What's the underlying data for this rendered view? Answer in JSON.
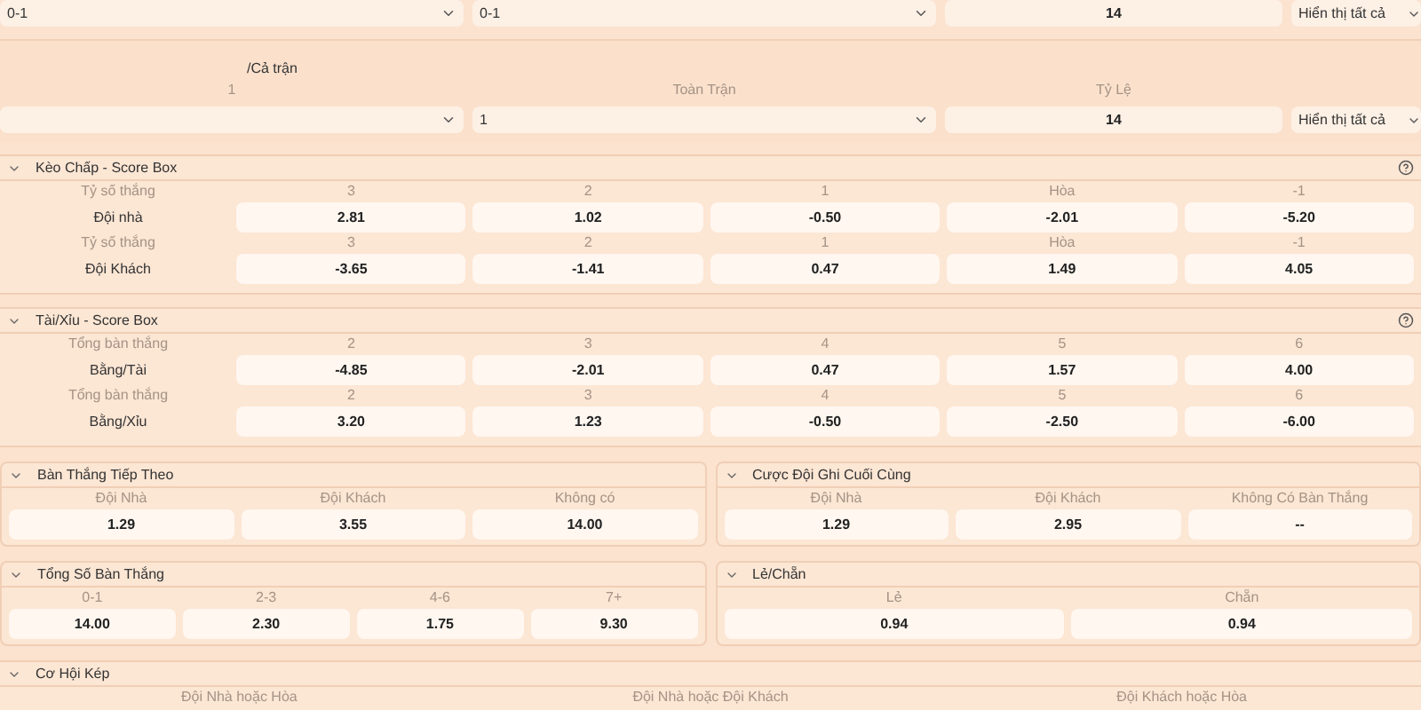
{
  "top_row": {
    "fields": [
      {
        "kind": "select",
        "value": "0-1"
      },
      {
        "kind": "select",
        "value": "0-1"
      },
      {
        "kind": "input",
        "value": "14"
      },
      {
        "kind": "filter",
        "value": "Hiển thị tất cả"
      }
    ]
  },
  "filter_panel": {
    "title": "/Cả trận",
    "labels": [
      "1",
      "Toàn Trận",
      "Tỷ Lệ"
    ],
    "fields": [
      {
        "kind": "select"
      },
      {
        "kind": "select",
        "value": "1"
      },
      {
        "kind": "input",
        "value": "14"
      },
      {
        "kind": "filter",
        "value": "Hiển thị tất cả"
      }
    ]
  },
  "score_sections": [
    {
      "title": "Kèo Chấp - Score Box",
      "expanded": true,
      "help": true,
      "groups": [
        {
          "header_label": "Tỷ số thắng",
          "row_label": "Đội nhà",
          "columns": [
            "3",
            "2",
            "1",
            "Hòa",
            "-1"
          ],
          "values": [
            "2.81",
            "1.02",
            "-0.50",
            "-2.01",
            "-5.20"
          ]
        },
        {
          "header_label": "Tỷ số thắng",
          "row_label": "Đội Khách",
          "columns": [
            "3",
            "2",
            "1",
            "Hòa",
            "-1"
          ],
          "values": [
            "-3.65",
            "-1.41",
            "0.47",
            "1.49",
            "4.05"
          ]
        }
      ]
    },
    {
      "title": "Tài/Xỉu - Score Box",
      "expanded": true,
      "help": true,
      "groups": [
        {
          "header_label": "Tổng bàn thắng",
          "row_label": "Bằng/Tài",
          "columns": [
            "2",
            "3",
            "4",
            "5",
            "6"
          ],
          "values": [
            "-4.85",
            "-2.01",
            "0.47",
            "1.57",
            "4.00"
          ]
        },
        {
          "header_label": "Tổng bàn thắng",
          "row_label": "Bằng/Xỉu",
          "columns": [
            "2",
            "3",
            "4",
            "5",
            "6"
          ],
          "values": [
            "3.20",
            "1.23",
            "-0.50",
            "-2.50",
            "-6.00"
          ]
        }
      ]
    }
  ],
  "pair_rows": [
    [
      {
        "title": "Bàn Thắng Tiếp Theo",
        "expanded": true,
        "columns": [
          "Đội Nhà",
          "Đội Khách",
          "Không có"
        ],
        "values": [
          "1.29",
          "3.55",
          "14.00"
        ]
      },
      {
        "title": "Cược Đội Ghi Cuối Cùng",
        "expanded": true,
        "columns": [
          "Đội Nhà",
          "Đội Khách",
          "Không Có Bàn Thắng"
        ],
        "values": [
          "1.29",
          "2.95",
          "--"
        ]
      }
    ],
    [
      {
        "title": "Tổng Số Bàn Thắng",
        "expanded": true,
        "columns": [
          "0-1",
          "2-3",
          "4-6",
          "7+"
        ],
        "values": [
          "14.00",
          "2.30",
          "1.75",
          "9.30"
        ]
      },
      {
        "title": "Lẻ/Chẵn",
        "expanded": true,
        "columns": [
          "Lẻ",
          "Chẵn"
        ],
        "values": [
          "0.94",
          "0.94"
        ]
      }
    ]
  ],
  "double_chance": {
    "title": "Cơ Hội Kép",
    "expanded": true,
    "columns": [
      "Đội Nhà hoặc Hòa",
      "Đội Nhà hoặc Đội Khách",
      "Đội Khách hoặc Hòa"
    ]
  }
}
